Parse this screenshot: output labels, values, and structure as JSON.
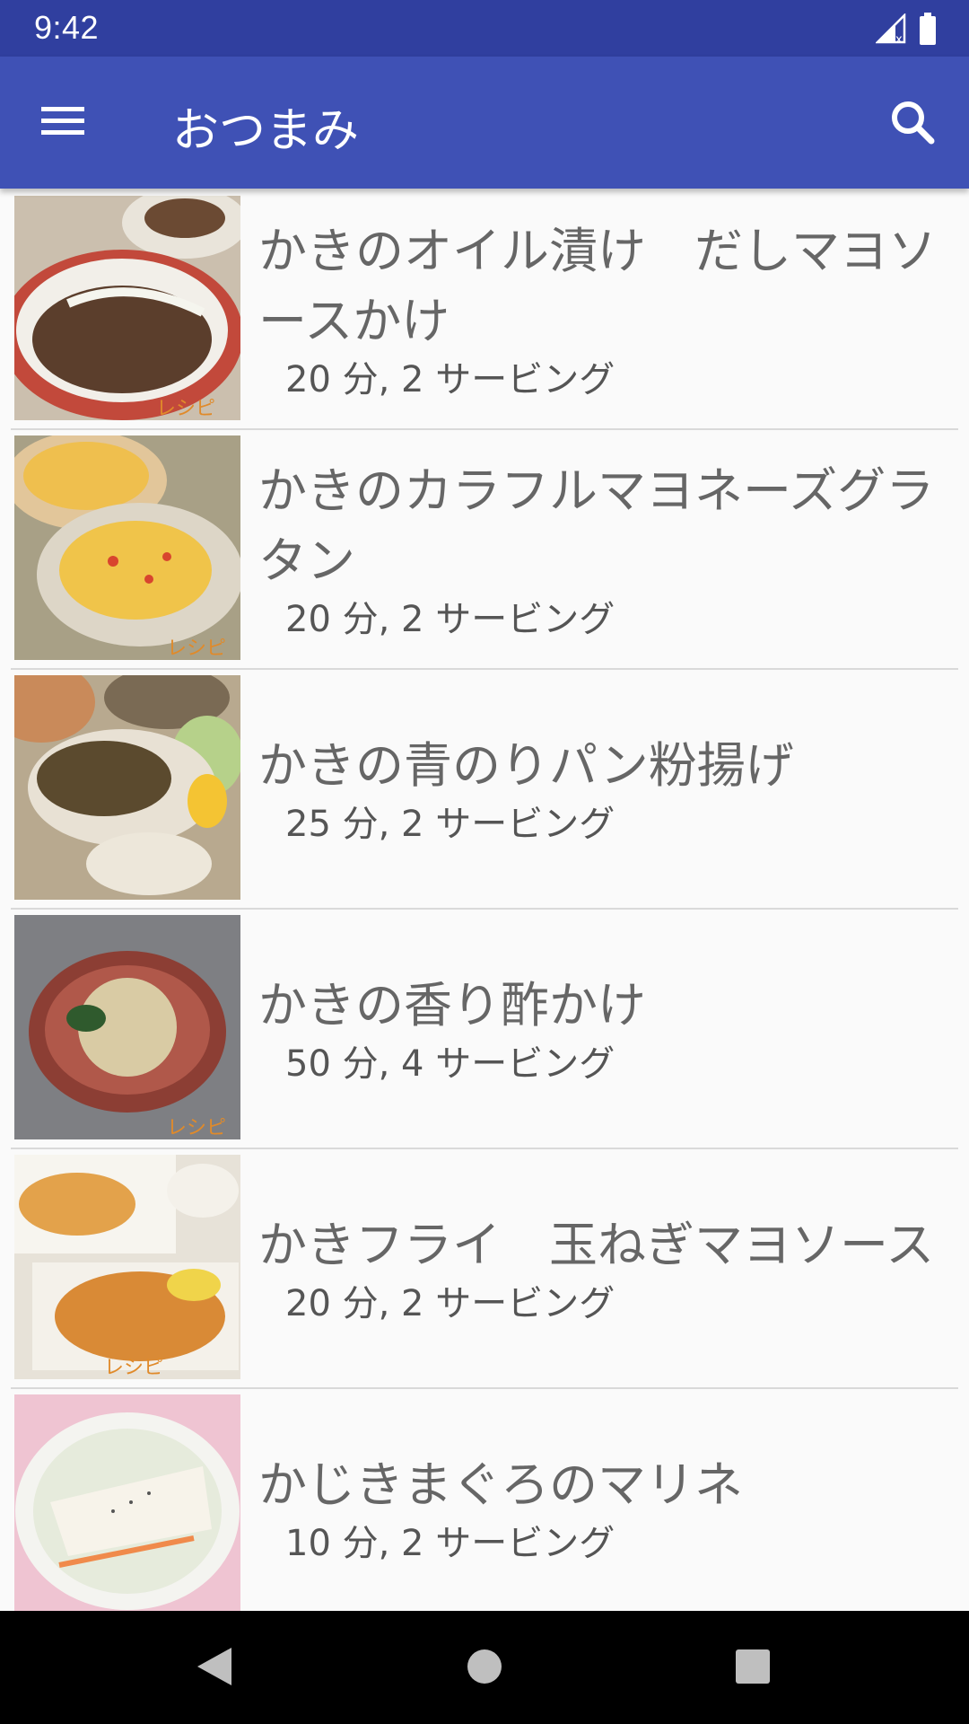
{
  "status_bar": {
    "time": "9:42"
  },
  "app_bar": {
    "title": "おつまみ"
  },
  "recipes": [
    {
      "title": "かきのオイル漬け　だしマヨソースかけ",
      "meta": "20 分, 2 サービング"
    },
    {
      "title": "かきのカラフルマヨネーズグラタン",
      "meta": "20 分, 2 サービング"
    },
    {
      "title": "かきの青のりパン粉揚げ",
      "meta": "25 分, 2 サービング"
    },
    {
      "title": "かきの香り酢かけ",
      "meta": "50 分, 4 サービング"
    },
    {
      "title": "かきフライ　玉ねぎマヨソース",
      "meta": "20 分, 2 サービング"
    },
    {
      "title": "かじきまぐろのマリネ",
      "meta": "10 分, 2 サービング"
    }
  ],
  "colors": {
    "primary": "#3f51b5",
    "primary_dark": "#303f9f",
    "background": "#fafafa"
  }
}
